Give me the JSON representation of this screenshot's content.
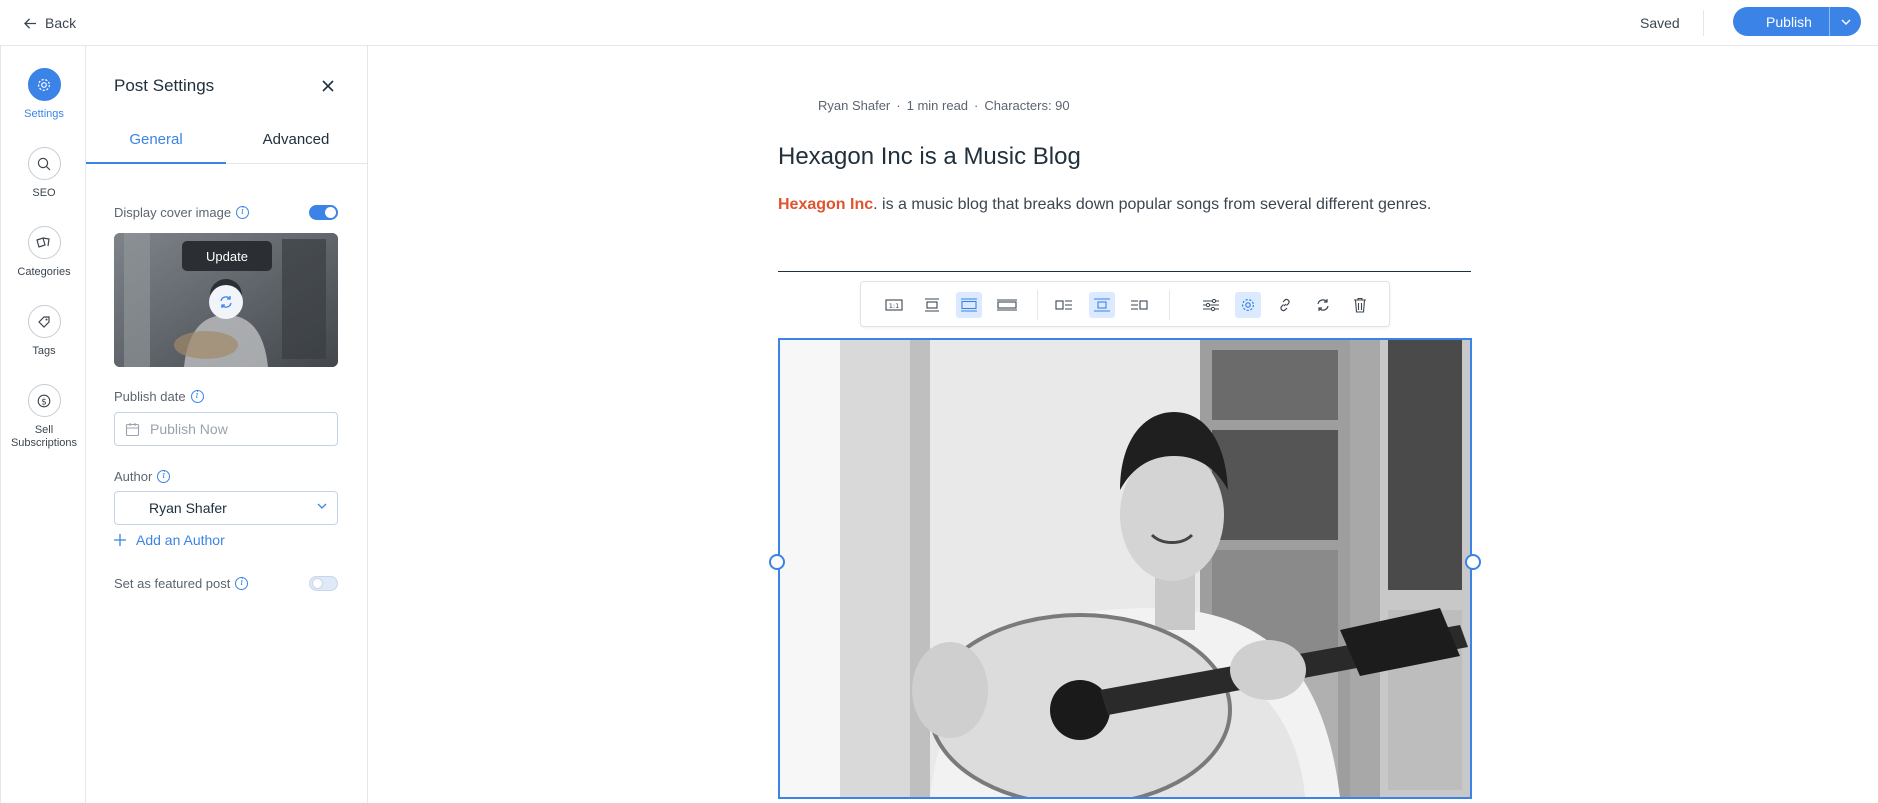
{
  "topbar": {
    "back_label": "Back",
    "status": "Saved",
    "publish_label": "Publish",
    "accent": "#3b83e6"
  },
  "rail": {
    "items": [
      {
        "label": "Settings",
        "icon": "gear-icon",
        "active": true
      },
      {
        "label": "SEO",
        "icon": "search-icon"
      },
      {
        "label": "Categories",
        "icon": "categories-icon"
      },
      {
        "label": "Tags",
        "icon": "tag-icon"
      },
      {
        "label": "Sell Subscriptions",
        "icon": "dollar-icon"
      }
    ]
  },
  "panel": {
    "title": "Post Settings",
    "tabs": [
      {
        "label": "General",
        "active": true
      },
      {
        "label": "Advanced"
      }
    ],
    "cover": {
      "label": "Display cover image",
      "enabled": true,
      "tooltip": "Update"
    },
    "publish_date": {
      "label": "Publish date",
      "placeholder": "Publish Now"
    },
    "author": {
      "label": "Author",
      "value": "Ryan Shafer",
      "add_label": "Add an Author"
    },
    "featured": {
      "label": "Set as featured post",
      "enabled": false
    }
  },
  "post": {
    "author": "Ryan Shafer",
    "read_time": "1 min read",
    "characters": "Characters: 90",
    "title": "Hexagon Inc is a Music Blog",
    "body_brand": "Hexagon Inc",
    "body_rest": ". is a music blog that breaks down popular songs from several different genres.",
    "brand_color": "#e0542f"
  },
  "toolbar": {
    "buttons": [
      {
        "name": "original-size-icon",
        "active": false
      },
      {
        "name": "small-center-icon",
        "active": false
      },
      {
        "name": "best-fit-icon",
        "active": true
      },
      {
        "name": "full-width-icon",
        "active": false
      },
      {
        "name": "align-left-icon",
        "active": false
      },
      {
        "name": "align-center-icon",
        "active": true
      },
      {
        "name": "align-right-icon",
        "active": false
      },
      {
        "name": "adjust-icon",
        "active": false
      },
      {
        "name": "settings-icon",
        "active": true
      },
      {
        "name": "link-icon",
        "active": false
      },
      {
        "name": "replace-icon",
        "active": false
      },
      {
        "name": "delete-icon",
        "active": false
      }
    ]
  }
}
